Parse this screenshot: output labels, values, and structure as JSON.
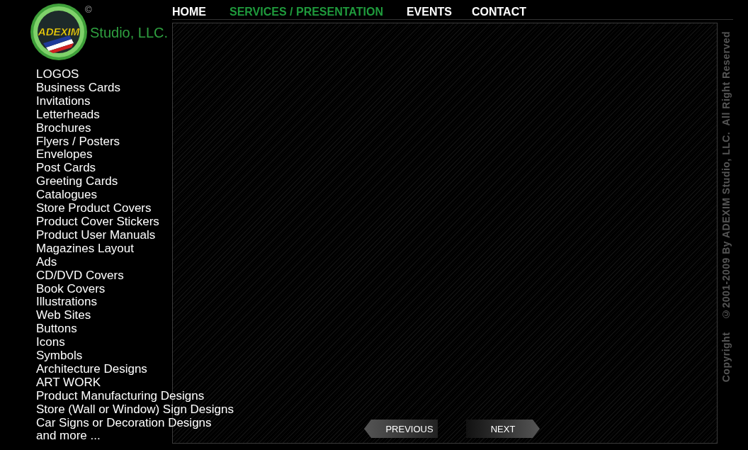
{
  "logo": {
    "mark_text": "ADEXIM",
    "copyright_mark": "©",
    "company": "Studio, LLC."
  },
  "nav": [
    {
      "label": "HOME",
      "selected": false
    },
    {
      "label": "SERVICES / PRESENTATION",
      "selected": true
    },
    {
      "label": "EVENTS",
      "selected": false
    },
    {
      "label": "CONTACT",
      "selected": false
    }
  ],
  "services": [
    "LOGOS",
    "Business Cards",
    "Invitations",
    "Letterheads",
    "Brochures",
    "Flyers / Posters",
    "Envelopes",
    "Post Cards",
    "Greeting Cards",
    "Catalogues",
    "Store Product Covers",
    "Product Cover Stickers",
    "Product User Manuals",
    "Magazines Layout",
    "Ads",
    "CD/DVD Covers",
    "Book Covers",
    "Illustrations",
    "Web Sites",
    "Buttons",
    "Icons",
    "Symbols",
    "Architecture Designs",
    "ART WORK",
    "Product Manufacturing Designs",
    "Store (Wall or Window) Sign Designs",
    "Car Signs or Decoration Designs",
    "and more ..."
  ],
  "pager": {
    "previous": "PREVIOUS",
    "next": "NEXT"
  },
  "copyright": "Copyright    ©2001-2009 By ADEXIM Studio, LLC.  All Right Reserved"
}
